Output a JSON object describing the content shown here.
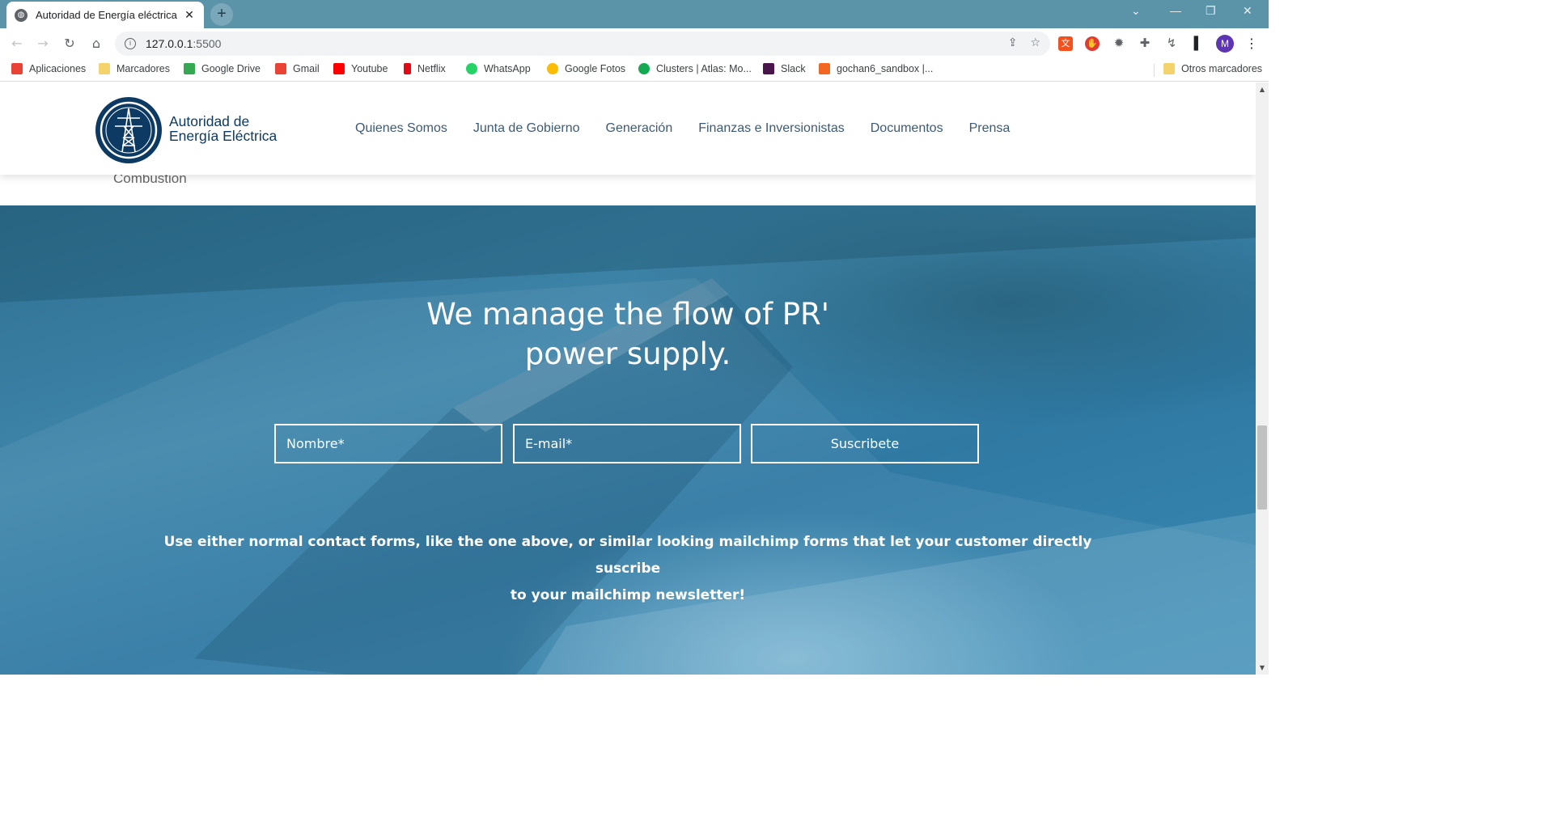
{
  "browser": {
    "tab_title": "Autoridad de Energía eléctrica",
    "tab_close": "✕",
    "new_tab": "+",
    "url_host": "127.0.0.1",
    "url_port": ":5500",
    "avatar_letter": "M",
    "window_controls": [
      "⌄",
      "—",
      "❐",
      "✕"
    ]
  },
  "bookmarks": [
    {
      "label": "Aplicaciones",
      "color": "#ea4335"
    },
    {
      "label": "Marcadores",
      "color": "#f4d36b"
    },
    {
      "label": "Google Drive",
      "color": "#34a853"
    },
    {
      "label": "Gmail",
      "color": "#ea4335"
    },
    {
      "label": "Youtube",
      "color": "#ff0000"
    },
    {
      "label": "Netflix",
      "color": "#e50914"
    },
    {
      "label": "WhatsApp",
      "color": "#25d366"
    },
    {
      "label": "Google Fotos",
      "color": "#fbbc05"
    },
    {
      "label": "Clusters | Atlas: Mo...",
      "color": "#13aa52"
    },
    {
      "label": "Slack",
      "color": "#4a154b"
    },
    {
      "label": "gochan6_sandbox |...",
      "color": "#f26722"
    },
    {
      "label": "Otros marcadores",
      "color": "#f4d36b"
    }
  ],
  "site": {
    "logo_line1": "Autoridad de",
    "logo_line2": "Energía Eléctrica",
    "nav": [
      "Quienes Somos",
      "Junta de Gobierno",
      "Generación",
      "Finanzas e Inversionistas",
      "Documentos",
      "Prensa"
    ],
    "peek_text": "Combustion"
  },
  "hero": {
    "title_line1": "We manage the flow of PR'",
    "title_line2": "power supply.",
    "name_placeholder": "Nombre*",
    "email_placeholder": "E-mail*",
    "submit_label": "Suscribete",
    "note_line1": "Use either normal contact forms, like the one above, or similar looking mailchimp forms that let your customer directly suscribe",
    "note_line2": "to your mailchimp newsletter!"
  },
  "colors": {
    "brand_navy": "#0d3a63",
    "tab_strip": "#5b93a9",
    "hero_blue": "#2f79a3"
  }
}
